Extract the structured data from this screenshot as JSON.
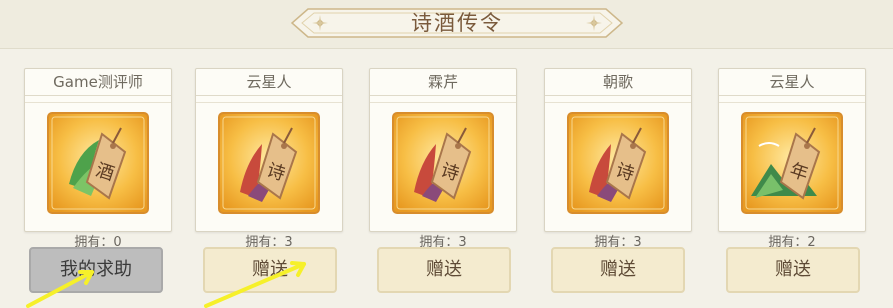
{
  "title": "诗酒传令",
  "cards": [
    {
      "name": "Game测评师",
      "glyph": "酒",
      "owned_label": "拥有：",
      "owned": "0",
      "button": "我的求助",
      "button_kind": "help",
      "style": "green-leaf"
    },
    {
      "name": "云星人",
      "glyph": "诗",
      "owned_label": "拥有：",
      "owned": "3",
      "button": "赠送",
      "button_kind": "gift",
      "style": "red-leaf"
    },
    {
      "name": "霖芹",
      "glyph": "诗",
      "owned_label": "拥有：",
      "owned": "3",
      "button": "赠送",
      "button_kind": "gift",
      "style": "red-leaf"
    },
    {
      "name": "朝歌",
      "glyph": "诗",
      "owned_label": "拥有：",
      "owned": "3",
      "button": "赠送",
      "button_kind": "gift",
      "style": "red-leaf"
    },
    {
      "name": "云星人",
      "glyph": "年",
      "owned_label": "拥有：",
      "owned": "2",
      "button": "赠送",
      "button_kind": "gift",
      "style": "green-mountain"
    }
  ],
  "colors": {
    "accent": "#7a5a3c",
    "gift_bg": "#f4ebcf",
    "help_bg": "#bdbdbd",
    "arrow": "#f6f02a"
  },
  "icons": {
    "title_ornament": "sparkle-diamond-icon",
    "token": "wooden-tag-token-icon",
    "pointer": "yellow-arrow-icon"
  }
}
